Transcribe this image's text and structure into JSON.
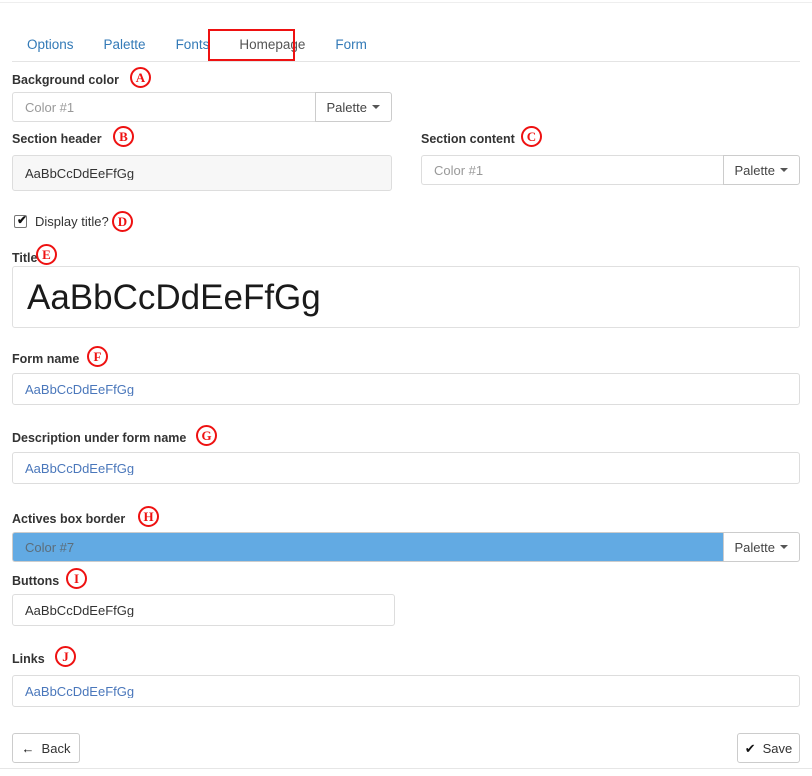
{
  "tabs": [
    {
      "label": "Options",
      "active": false
    },
    {
      "label": "Palette",
      "active": false
    },
    {
      "label": "Fonts",
      "active": false
    },
    {
      "label": "Homepage",
      "active": true
    },
    {
      "label": "Form",
      "active": false
    }
  ],
  "fields": {
    "background_color": {
      "label": "Background color",
      "marker": "A",
      "value": "Color #1",
      "palette_label": "Palette"
    },
    "section_header": {
      "label": "Section header",
      "marker": "B",
      "value": "AaBbCcDdEeFfGg"
    },
    "section_content": {
      "label": "Section content",
      "marker": "C",
      "value": "Color #1",
      "palette_label": "Palette"
    },
    "display_title": {
      "label": "Display title?",
      "marker": "D",
      "checked": true,
      "tick": "✔"
    },
    "title": {
      "label": "Title",
      "marker": "E",
      "value": "AaBbCcDdEeFfGg"
    },
    "form_name": {
      "label": "Form name",
      "marker": "F",
      "value": "AaBbCcDdEeFfGg"
    },
    "description": {
      "label": "Description under form name",
      "marker": "G",
      "value": "AaBbCcDdEeFfGg"
    },
    "actives_box_border": {
      "label": "Actives box border",
      "marker": "H",
      "value": "Color #7",
      "palette_label": "Palette",
      "swatch_color": "#62aae3"
    },
    "buttons": {
      "label": "Buttons",
      "marker": "I",
      "value": "AaBbCcDdEeFfGg"
    },
    "links": {
      "label": "Links",
      "marker": "J",
      "value": "AaBbCcDdEeFfGg"
    }
  },
  "footer": {
    "back_label": "Back",
    "back_glyph": "←",
    "save_label": "Save",
    "save_glyph": "✔"
  },
  "colors": {
    "tab_link": "#337ab7",
    "annotation_red": "#ee1111",
    "link_text": "#4a77bb",
    "palette_blue": "#62aae3"
  }
}
